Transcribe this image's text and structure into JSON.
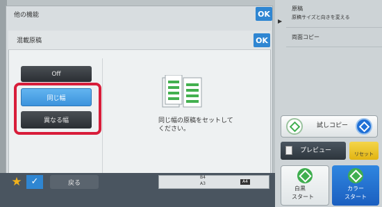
{
  "outer_dialog": {
    "title": "他の機能",
    "ok_label": "OK"
  },
  "inner_dialog": {
    "title": "混載原稿",
    "ok_label": "OK"
  },
  "options": [
    {
      "label": "Off",
      "selected": false
    },
    {
      "label": "同じ幅",
      "selected": true
    },
    {
      "label": "異なる幅",
      "selected": false
    }
  ],
  "instruction": {
    "line1": "同じ幅の原稿をセットして",
    "line2": "ください。"
  },
  "right_panel": {
    "original_title": "原稿",
    "original_sub": "原稿サイズと向きを変える",
    "duplex_copy": "両面コピー",
    "test_copy": "試しコピー",
    "preview": "プレビュー",
    "reset": "リセット",
    "bw_start_line1": "白黒",
    "bw_start_line2": "スタート",
    "color_start_line1": "カラー",
    "color_start_line2": "スタート"
  },
  "bottom_bar": {
    "back_label": "戻る",
    "paper_b4": "B4",
    "paper_a3": "A3",
    "paper_a4": "A4"
  },
  "colors": {
    "accent": "#2f86d2",
    "highlight": "#d81d3a",
    "selected_option": "#4aa3e8",
    "start_green": "#3fae4f",
    "color_start_blue": "#1f6fd6"
  }
}
